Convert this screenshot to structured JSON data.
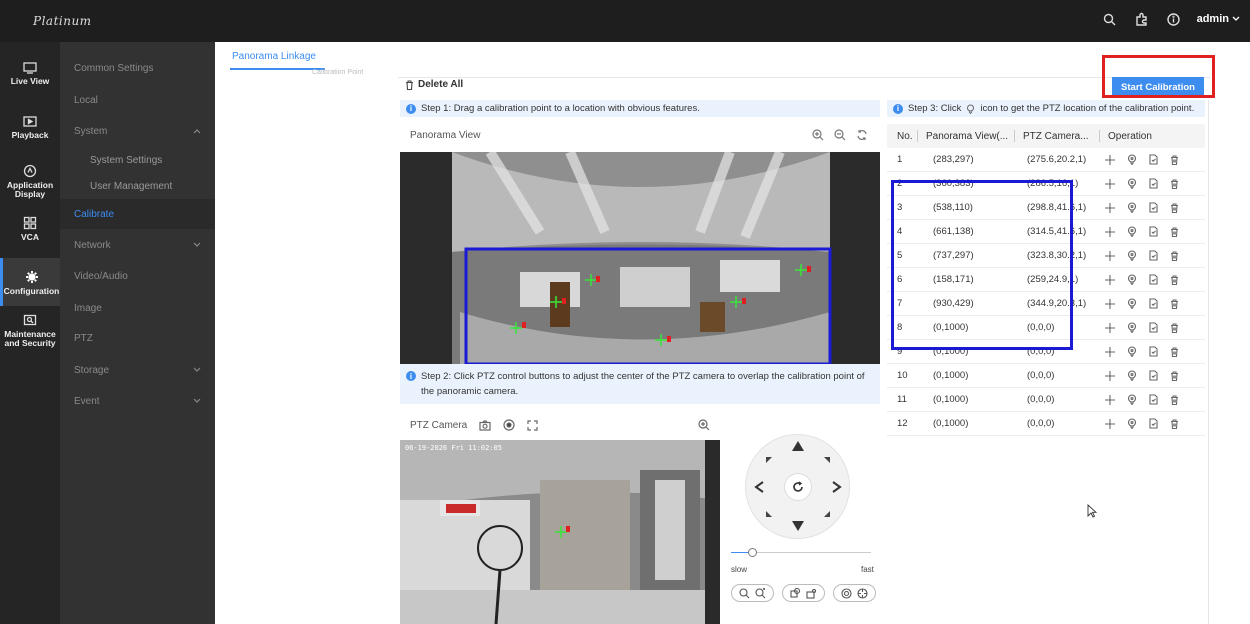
{
  "brand": "Platinum",
  "header": {
    "user": "admin"
  },
  "rail": [
    {
      "label": "Live View",
      "icon": "monitor-icon"
    },
    {
      "label": "Playback",
      "icon": "playback-icon"
    },
    {
      "label": "Application Display",
      "icon": "application-icon"
    },
    {
      "label": "VCA",
      "icon": "vca-icon"
    },
    {
      "label": "Configuration",
      "icon": "gear-icon",
      "active": true
    },
    {
      "label": "Maintenance and Security",
      "icon": "maintenance-icon"
    }
  ],
  "menu": [
    {
      "label": "Common Settings",
      "type": "top"
    },
    {
      "label": "Local",
      "type": "top"
    },
    {
      "label": "System",
      "type": "top",
      "expandable": true,
      "expanded": true
    },
    {
      "label": "System Settings",
      "type": "sub"
    },
    {
      "label": "User Management",
      "type": "sub"
    },
    {
      "label": "Calibrate",
      "type": "top",
      "active": true
    },
    {
      "label": "Network",
      "type": "top",
      "expandable": true
    },
    {
      "label": "Video/Audio",
      "type": "top"
    },
    {
      "label": "Image",
      "type": "top"
    },
    {
      "label": "PTZ",
      "type": "top"
    },
    {
      "label": "Storage",
      "type": "top",
      "expandable": true
    },
    {
      "label": "Event",
      "type": "top",
      "expandable": true
    }
  ],
  "tabs": {
    "active": "Panorama Linkage",
    "ghost": "Calibration Point"
  },
  "toolbar": {
    "delete_all": "Delete All",
    "start_calibration": "Start Calibration"
  },
  "steps": {
    "step1": "Step 1: Drag a calibration point to a location with obvious features.",
    "step2": "Step 2: Click PTZ control buttons to adjust the center of the PTZ camera to overlap the calibration point of the panoramic camera.",
    "step3_pre": "Step 3: Click",
    "step3_post": "icon to get the PTZ location of the calibration point."
  },
  "panorama": {
    "title": "Panorama View"
  },
  "ptz": {
    "title": "PTZ Camera",
    "osd": "06-19-2026 Fri 11:02:05",
    "speed_min": "slow",
    "speed_max": "fast",
    "speed_level": 0.15
  },
  "table": {
    "headers": {
      "no": "No.",
      "panorama": "Panorama View(...",
      "ptz": "PTZ Camera...",
      "operation": "Operation"
    },
    "rows": [
      {
        "no": "1",
        "pan": "(283,297)",
        "ptz": "(275.6,20.2,1)"
      },
      {
        "no": "2",
        "pan": "(360,383)",
        "ptz": "(286.5,16,1)"
      },
      {
        "no": "3",
        "pan": "(538,110)",
        "ptz": "(298.8,41.6,1)"
      },
      {
        "no": "4",
        "pan": "(661,138)",
        "ptz": "(314.5,41.6,1)"
      },
      {
        "no": "5",
        "pan": "(737,297)",
        "ptz": "(323.8,30.2,1)"
      },
      {
        "no": "6",
        "pan": "(158,171)",
        "ptz": "(259,24.9,1)"
      },
      {
        "no": "7",
        "pan": "(930,429)",
        "ptz": "(344.9,20.3,1)"
      },
      {
        "no": "8",
        "pan": "(0,1000)",
        "ptz": "(0,0,0)"
      },
      {
        "no": "9",
        "pan": "(0,1000)",
        "ptz": "(0,0,0)"
      },
      {
        "no": "10",
        "pan": "(0,1000)",
        "ptz": "(0,0,0)"
      },
      {
        "no": "11",
        "pan": "(0,1000)",
        "ptz": "(0,0,0)"
      },
      {
        "no": "12",
        "pan": "(0,1000)",
        "ptz": "(0,0,0)"
      }
    ]
  },
  "colors": {
    "accent": "#3d8cf0",
    "highlight_red": "#e0211f",
    "highlight_blue": "#1a1ad4"
  }
}
